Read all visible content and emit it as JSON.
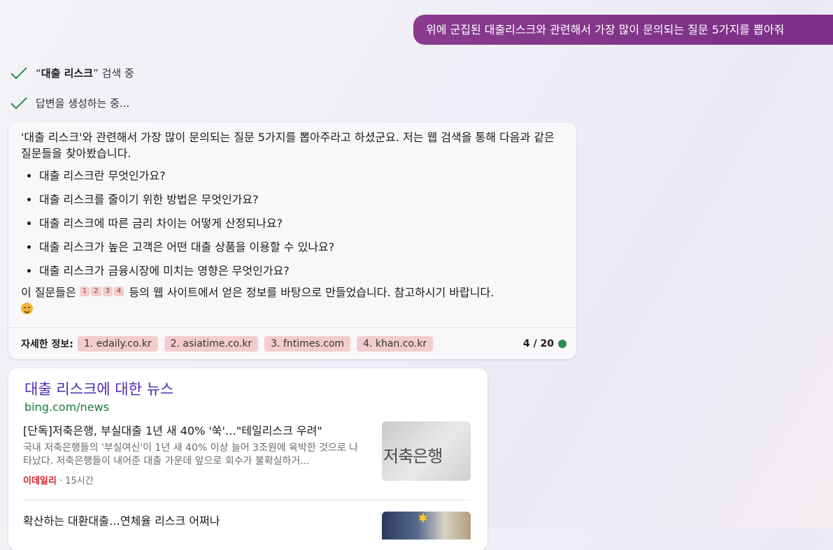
{
  "user_message": "위에 군집된 대출리스크와 관련해서 가장 많이 문의되는 질문 5가지를 뽑아줘",
  "status": [
    {
      "prefix": "“",
      "query": "대출 리스크",
      "suffix": "” 검색 중"
    },
    {
      "text": "답변을 생성하는 중..."
    }
  ],
  "answer": {
    "intro": "'대출 리스크'와 관련해서 가장 많이 문의되는 질문 5가지를 뽑아주라고 하셨군요. 저는 웹 검색을 통해 다음과 같은 질문들을 찾아봤습니다.",
    "questions": [
      "대출 리스크란 무엇인가요?",
      "대출 리스크를 줄이기 위한 방법은 무엇인가요?",
      "대출 리스크에 따른 금리 차이는 어떻게 산정되나요?",
      "대출 리스크가 높은 고객은 어떤 대출 상품을 이용할 수 있나요?",
      "대출 리스크가 금융시장에 미치는 영향은 무엇인가요?"
    ],
    "outro_prefix": "이 질문들은",
    "citations": [
      "1",
      "2",
      "3",
      "4"
    ],
    "outro_suffix": "등의 웹 사이트에서 얻은 정보를 바탕으로 만들었습니다. 참고하시기 바랍니다.",
    "emoji": "smiling-face-icon",
    "learn_more_label": "자세한 정보:",
    "sources": [
      "1. edaily.co.kr",
      "2. asiatime.co.kr",
      "3. fntimes.com",
      "4. khan.co.kr"
    ],
    "turn_counter": "4 / 20",
    "status_dot_color": "#2e8b4e"
  },
  "news": {
    "title": "대출 리스크에 대한 뉴스",
    "url": "bing.com/news",
    "articles": [
      {
        "headline": "[단독]저축은행, 부실대출 1년 새 40% '쑥'…\"테일리스크 우려\"",
        "snippet": "국내 저축은행들의 '부실여신'이 1년 새 40% 이상 늘어 3조원에 육박한 것으로 나타났다. 저축은행들이 내어준 대출 가운데 앞으로 회수가 불확실하거...",
        "source": "이데일리",
        "time": "· 15시간",
        "thumb_text": "저축은행"
      },
      {
        "headline": "확산하는 대환대출…연체율 리스크 어쩌나"
      }
    ]
  }
}
